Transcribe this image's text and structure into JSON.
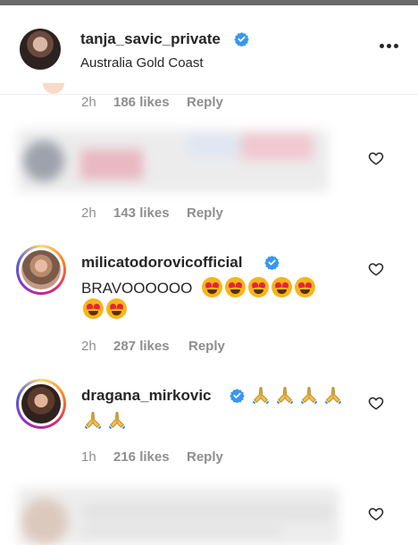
{
  "header": {
    "username": "tanja_savic_private",
    "location": "Australia Gold Coast",
    "verified": true
  },
  "comments": [
    {
      "time": "2h",
      "likes": "186 likes",
      "reply": "Reply",
      "blurred": true,
      "partial": true
    },
    {
      "time": "2h",
      "likes": "143 likes",
      "reply": "Reply",
      "blurred": true
    },
    {
      "username": "milicatodorovicofficial",
      "verified": true,
      "text": "BRAVOOOOOO",
      "emoji_line1": [
        "heart-eyes",
        "heart-eyes",
        "heart-eyes",
        "heart-eyes",
        "heart-eyes"
      ],
      "emoji_line2": [
        "heart-eyes",
        "heart-eyes"
      ],
      "time": "2h",
      "likes": "287 likes",
      "reply": "Reply"
    },
    {
      "username": "dragana_mirkovic",
      "verified": true,
      "emoji_line1": [
        "folded-hands",
        "folded-hands",
        "folded-hands",
        "folded-hands"
      ],
      "emoji_line2": [
        "folded-hands",
        "folded-hands"
      ],
      "time": "1h",
      "likes": "216 likes",
      "reply": "Reply"
    },
    {
      "blurred": true,
      "partial": true
    }
  ],
  "colors": {
    "verified": "#3897f0",
    "meta_text": "#8e8e8e",
    "text": "#262626"
  }
}
